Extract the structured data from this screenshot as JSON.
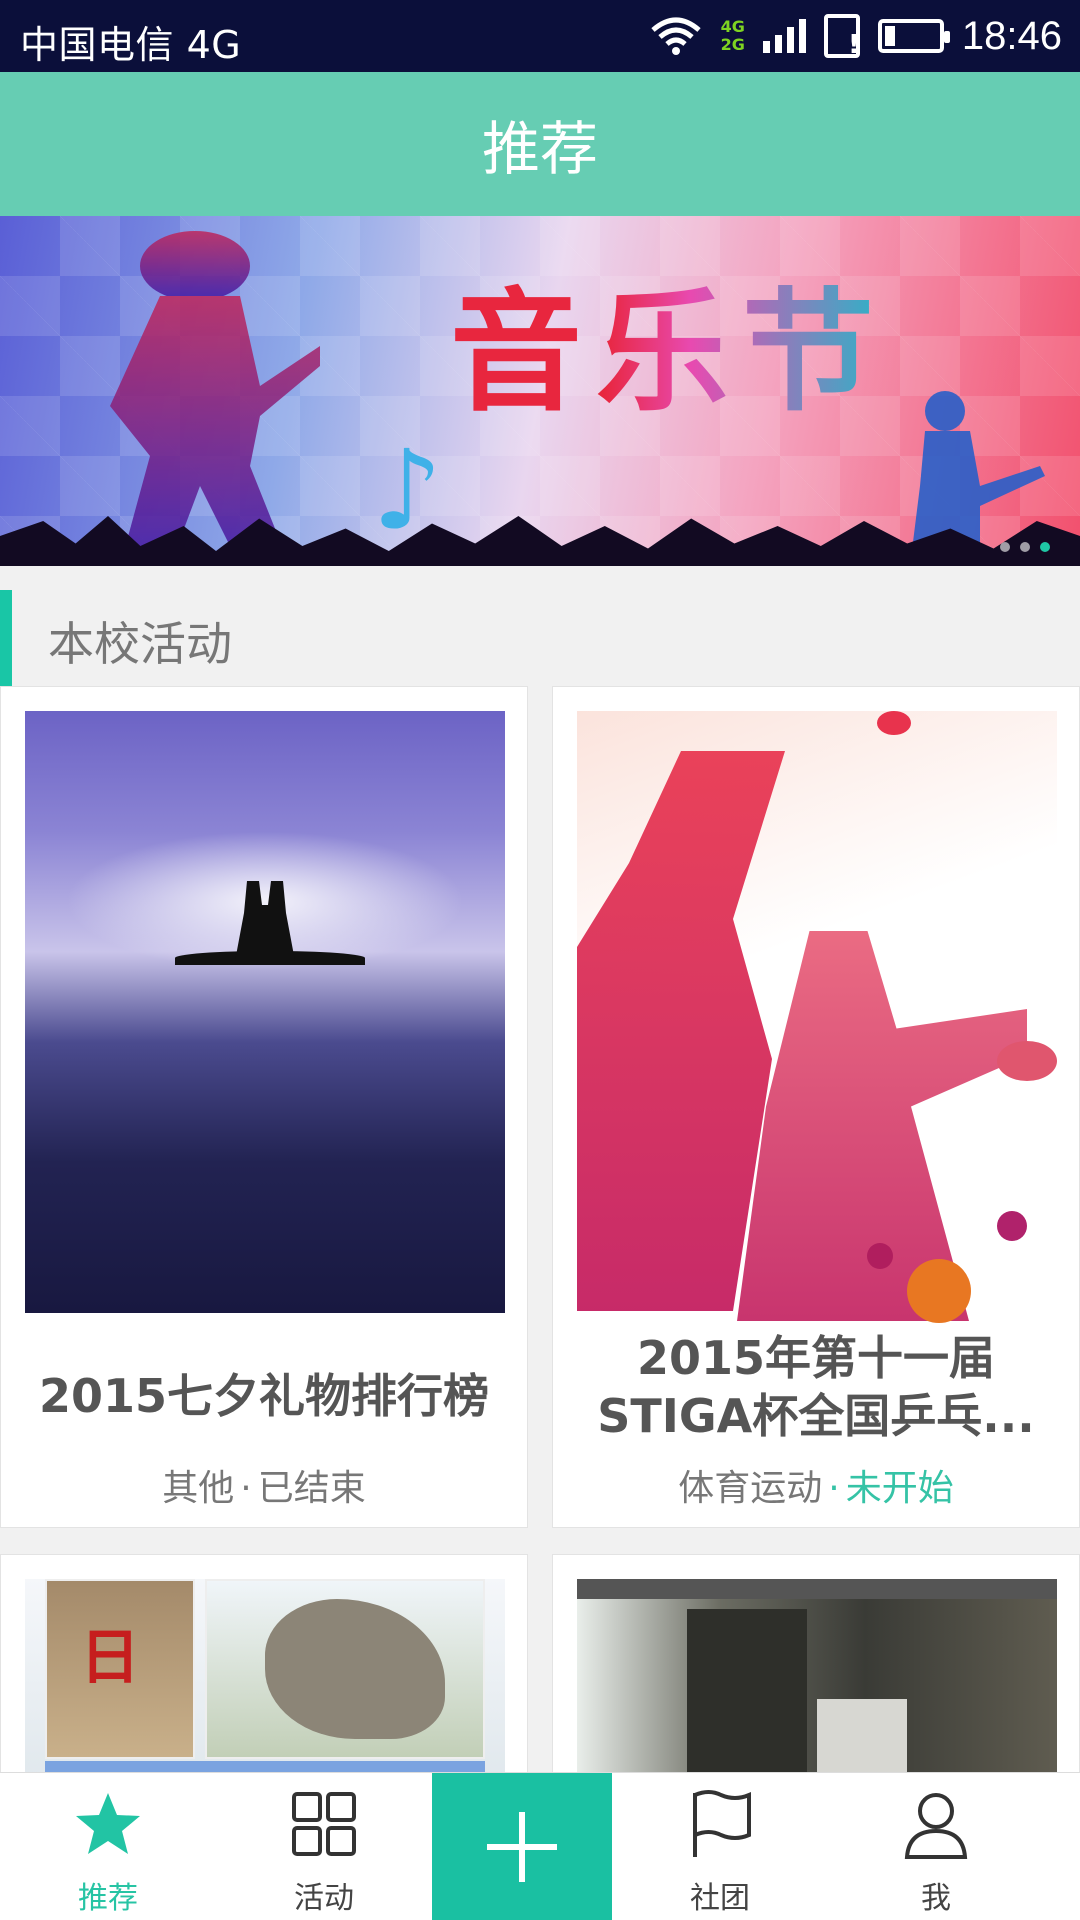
{
  "status_bar": {
    "carrier": "中国电信 4G",
    "network_tags": [
      "4G",
      "2G"
    ],
    "time": "18:46",
    "battery_level": 0.15
  },
  "header": {
    "title": "推荐"
  },
  "banner": {
    "title": "音乐节",
    "slide_count": 3,
    "active_index": 2
  },
  "section": {
    "label": "本校活动"
  },
  "cards": [
    {
      "title": "2015七夕礼物排行榜",
      "category": "其他",
      "separator": "·",
      "status": "已结束",
      "status_color": "#777777"
    },
    {
      "title": "2015年第十一届STIGA杯全国乒乓...",
      "category": "体育运动",
      "separator": "·",
      "status": "未开始",
      "status_color": "#35c3a6"
    }
  ],
  "nav": {
    "items": [
      {
        "label": "推荐",
        "icon": "star-icon",
        "active": true
      },
      {
        "label": "活动",
        "icon": "grid-icon",
        "active": false
      },
      {
        "label": "",
        "icon": "plus-icon",
        "active": false
      },
      {
        "label": "社团",
        "icon": "flag-icon",
        "active": false
      },
      {
        "label": "我",
        "icon": "person-icon",
        "active": false
      }
    ]
  },
  "colors": {
    "accent": "#19c6a6",
    "header": "#66cdb3",
    "status_bar": "#0b0f3a"
  }
}
